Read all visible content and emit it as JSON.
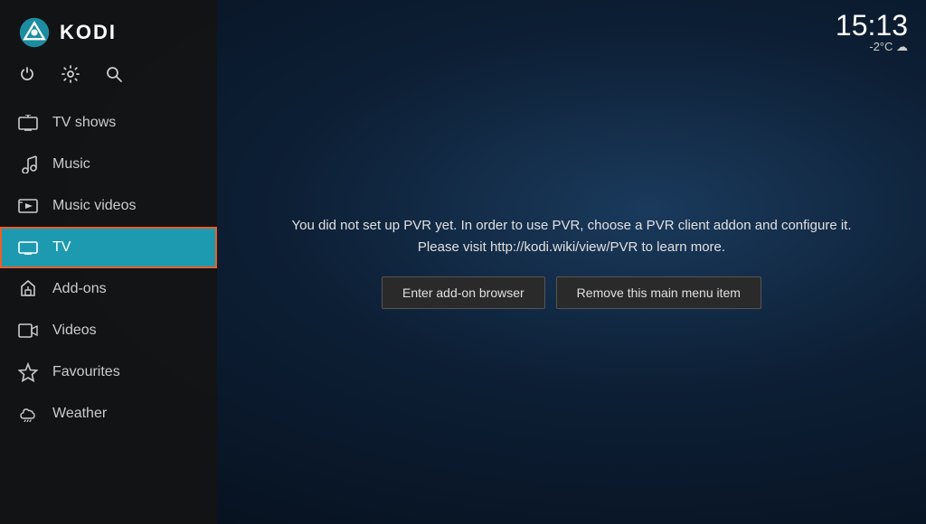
{
  "app": {
    "title": "KODI"
  },
  "clock": {
    "time": "15:13",
    "weather": "-2°C ☁"
  },
  "system_icons": [
    {
      "name": "power-icon",
      "symbol": "⏻"
    },
    {
      "name": "settings-icon",
      "symbol": "⚙"
    },
    {
      "name": "search-icon",
      "symbol": "🔍"
    }
  ],
  "nav": {
    "items": [
      {
        "id": "tv-shows",
        "label": "TV shows",
        "icon": "tv-shows-icon",
        "active": false
      },
      {
        "id": "music",
        "label": "Music",
        "icon": "music-icon",
        "active": false
      },
      {
        "id": "music-videos",
        "label": "Music videos",
        "icon": "music-videos-icon",
        "active": false
      },
      {
        "id": "tv",
        "label": "TV",
        "icon": "tv-icon",
        "active": true
      },
      {
        "id": "add-ons",
        "label": "Add-ons",
        "icon": "addons-icon",
        "active": false
      },
      {
        "id": "videos",
        "label": "Videos",
        "icon": "videos-icon",
        "active": false
      },
      {
        "id": "favourites",
        "label": "Favourites",
        "icon": "favourites-icon",
        "active": false
      },
      {
        "id": "weather",
        "label": "Weather",
        "icon": "weather-icon",
        "active": false
      }
    ]
  },
  "pvr": {
    "message_line1": "You did not set up PVR yet. In order to use PVR, choose a PVR client addon and configure it.",
    "message_line2": "Please visit http://kodi.wiki/view/PVR to learn more.",
    "button_addon_browser": "Enter add-on browser",
    "button_remove_menu": "Remove this main menu item"
  }
}
